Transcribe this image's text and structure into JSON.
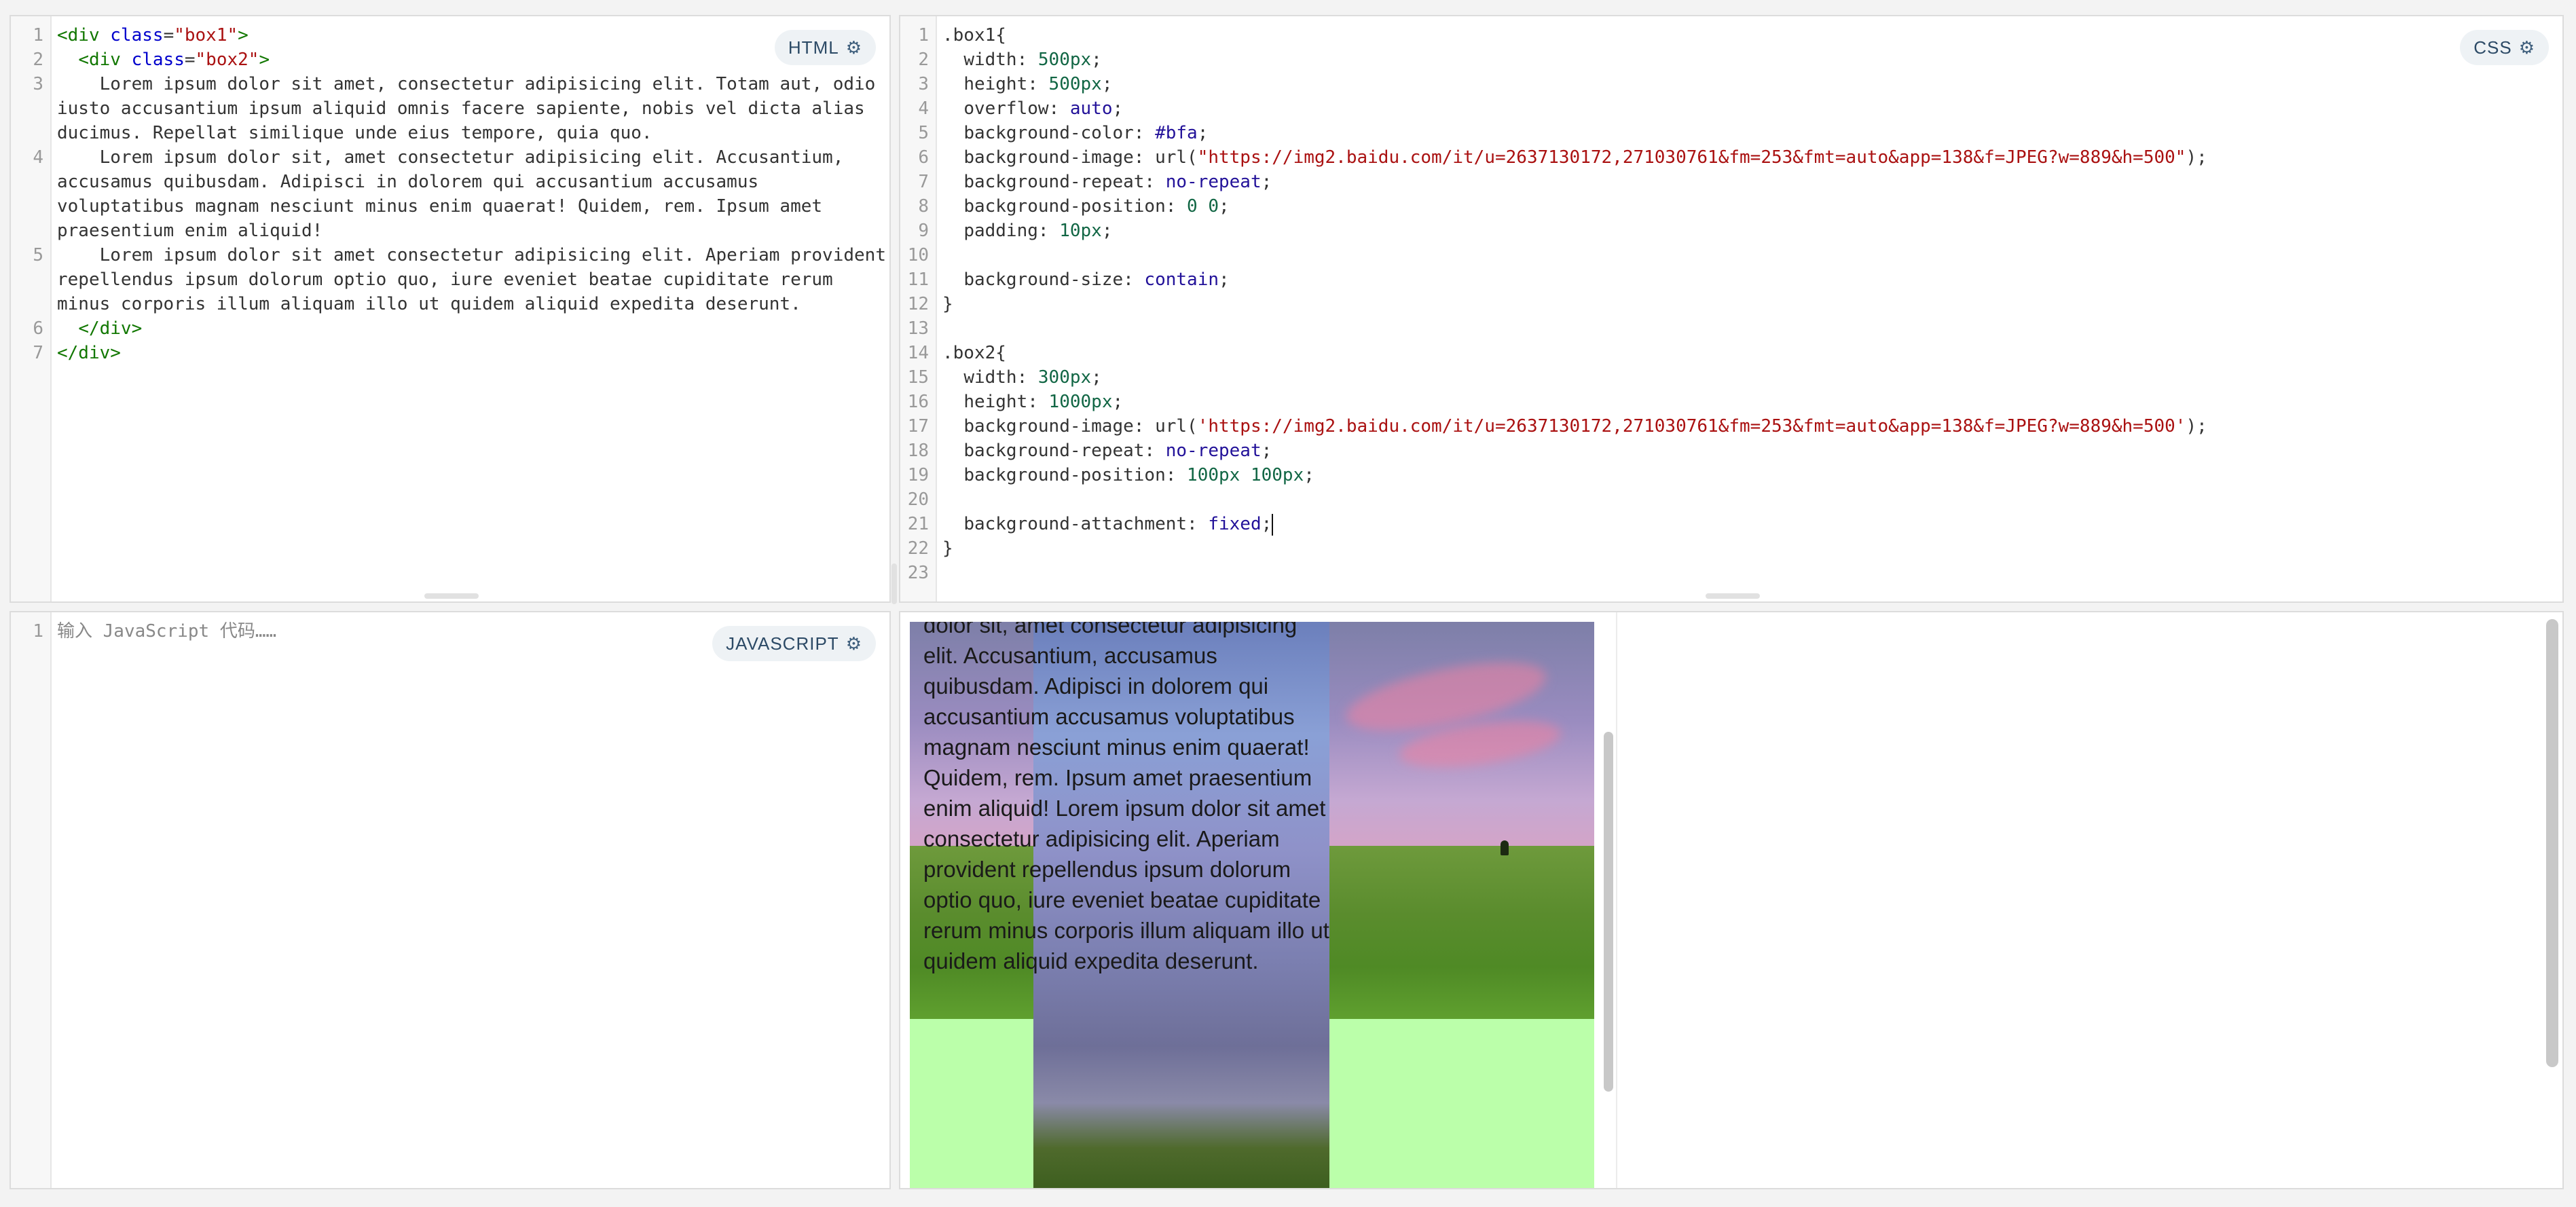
{
  "html_panel": {
    "label": "HTML",
    "lines": [
      {
        "n": "1",
        "parts": [
          [
            "t-tag",
            "<div "
          ],
          [
            "t-attr",
            "class"
          ],
          [
            "t-punct",
            "="
          ],
          [
            "t-str",
            "\"box1\""
          ],
          [
            "t-tag",
            ">"
          ]
        ]
      },
      {
        "n": "2",
        "parts": [
          [
            "t-punct",
            "  "
          ],
          [
            "t-tag",
            "<div "
          ],
          [
            "t-attr",
            "class"
          ],
          [
            "t-punct",
            "="
          ],
          [
            "t-str",
            "\"box2\""
          ],
          [
            "t-tag",
            ">"
          ]
        ]
      },
      {
        "n": "3",
        "parts": [
          [
            "t-prop",
            "    Lorem ipsum dolor sit amet, consectetur adipisicing elit. Totam aut, odio iusto accusantium ipsum aliquid omnis facere sapiente, nobis vel dicta alias ducimus. Repellat similique unde eius tempore, quia quo."
          ]
        ]
      },
      {
        "n": "4",
        "parts": [
          [
            "t-prop",
            "    Lorem ipsum dolor sit, amet consectetur adipisicing elit. Accusantium, accusamus quibusdam. Adipisci in dolorem qui accusantium accusamus voluptatibus magnam nesciunt minus enim quaerat! Quidem, rem. Ipsum amet praesentium enim aliquid!"
          ]
        ]
      },
      {
        "n": "5",
        "parts": [
          [
            "t-prop",
            "    Lorem ipsum dolor sit amet consectetur adipisicing elit. Aperiam provident repellendus ipsum dolorum optio quo, iure eveniet beatae cupiditate rerum minus corporis illum aliquam illo ut quidem aliquid expedita deserunt."
          ]
        ]
      },
      {
        "n": "6",
        "parts": [
          [
            "t-punct",
            "  "
          ],
          [
            "t-tag",
            "</div>"
          ]
        ]
      },
      {
        "n": "7",
        "parts": [
          [
            "t-tag",
            "</div>"
          ]
        ]
      }
    ]
  },
  "css_panel": {
    "label": "CSS",
    "lines": [
      {
        "n": "1",
        "parts": [
          [
            "t-prop",
            ".box1{"
          ]
        ]
      },
      {
        "n": "2",
        "parts": [
          [
            "t-prop",
            "  width: "
          ],
          [
            "t-num",
            "500px"
          ],
          [
            "t-prop",
            ";"
          ]
        ]
      },
      {
        "n": "3",
        "parts": [
          [
            "t-prop",
            "  height: "
          ],
          [
            "t-num",
            "500px"
          ],
          [
            "t-prop",
            ";"
          ]
        ]
      },
      {
        "n": "4",
        "parts": [
          [
            "t-prop",
            "  overflow: "
          ],
          [
            "t-kw",
            "auto"
          ],
          [
            "t-prop",
            ";"
          ]
        ]
      },
      {
        "n": "5",
        "parts": [
          [
            "t-prop",
            "  background-color: "
          ],
          [
            "t-atom",
            "#bfa"
          ],
          [
            "t-prop",
            ";"
          ]
        ]
      },
      {
        "n": "6",
        "parts": [
          [
            "t-prop",
            "  background-image: url("
          ],
          [
            "t-str",
            "\"https://img2.baidu.com/it/u=2637130172,271030761&fm=253&fmt=auto&app=138&f=JPEG?w=889&h=500\""
          ],
          [
            "t-prop",
            ");"
          ]
        ]
      },
      {
        "n": "7",
        "parts": [
          [
            "t-prop",
            "  background-repeat: "
          ],
          [
            "t-kw",
            "no-repeat"
          ],
          [
            "t-prop",
            ";"
          ]
        ]
      },
      {
        "n": "8",
        "parts": [
          [
            "t-prop",
            "  background-position: "
          ],
          [
            "t-num",
            "0 0"
          ],
          [
            "t-prop",
            ";"
          ]
        ]
      },
      {
        "n": "9",
        "parts": [
          [
            "t-prop",
            "  padding: "
          ],
          [
            "t-num",
            "10px"
          ],
          [
            "t-prop",
            ";"
          ]
        ]
      },
      {
        "n": "10",
        "parts": [
          [
            "t-prop",
            ""
          ]
        ]
      },
      {
        "n": "11",
        "parts": [
          [
            "t-prop",
            "  background-size: "
          ],
          [
            "t-kw",
            "contain"
          ],
          [
            "t-prop",
            ";"
          ]
        ]
      },
      {
        "n": "12",
        "parts": [
          [
            "t-prop",
            "}"
          ]
        ]
      },
      {
        "n": "13",
        "parts": [
          [
            "t-prop",
            ""
          ]
        ]
      },
      {
        "n": "14",
        "parts": [
          [
            "t-prop",
            ".box2{"
          ]
        ]
      },
      {
        "n": "15",
        "parts": [
          [
            "t-prop",
            "  width: "
          ],
          [
            "t-num",
            "300px"
          ],
          [
            "t-prop",
            ";"
          ]
        ]
      },
      {
        "n": "16",
        "parts": [
          [
            "t-prop",
            "  height: "
          ],
          [
            "t-num",
            "1000px"
          ],
          [
            "t-prop",
            ";"
          ]
        ]
      },
      {
        "n": "17",
        "parts": [
          [
            "t-prop",
            "  background-image: url("
          ],
          [
            "t-str",
            "'https://img2.baidu.com/it/u=2637130172,271030761&fm=253&fmt=auto&app=138&f=JPEG?w=889&h=500'"
          ],
          [
            "t-prop",
            ");"
          ]
        ]
      },
      {
        "n": "18",
        "parts": [
          [
            "t-prop",
            "  background-repeat: "
          ],
          [
            "t-kw",
            "no-repeat"
          ],
          [
            "t-prop",
            ";"
          ]
        ]
      },
      {
        "n": "19",
        "parts": [
          [
            "t-prop",
            "  background-position: "
          ],
          [
            "t-num",
            "100px 100px"
          ],
          [
            "t-prop",
            ";"
          ]
        ]
      },
      {
        "n": "20",
        "parts": [
          [
            "t-prop",
            ""
          ]
        ]
      },
      {
        "n": "21",
        "parts": [
          [
            "t-prop",
            "  background-attachment: "
          ],
          [
            "t-kw",
            "fixed"
          ],
          [
            "t-prop",
            ";"
          ]
        ],
        "cursor": true
      },
      {
        "n": "22",
        "parts": [
          [
            "t-prop",
            "}"
          ]
        ]
      },
      {
        "n": "23",
        "parts": [
          [
            "t-prop",
            ""
          ]
        ]
      }
    ]
  },
  "js_panel": {
    "label": "JAVASCRIPT",
    "line_number": "1",
    "placeholder": "输入 JavaScript 代码……"
  },
  "result": {
    "text": "dolor sit, amet consectetur adipisicing elit. Accusantium, accusamus quibusdam. Adipisci in dolorem qui accusantium accusamus voluptatibus magnam nesciunt minus enim quaerat! Quidem, rem. Ipsum amet praesentium enim aliquid! Lorem ipsum dolor sit amet consectetur adipisicing elit. Aperiam provident repellendus ipsum dolorum optio quo, iure eveniet beatae cupiditate rerum minus corporis illum aliquam illo ut quidem aliquid expedita deserunt."
  },
  "icons": {
    "gear": "gear-icon"
  },
  "colors": {
    "box1_bg": "#bbffaa",
    "tag": "#117700",
    "attr": "#0000cc",
    "string": "#aa1111",
    "number": "#116644",
    "keyword": "#221199"
  }
}
